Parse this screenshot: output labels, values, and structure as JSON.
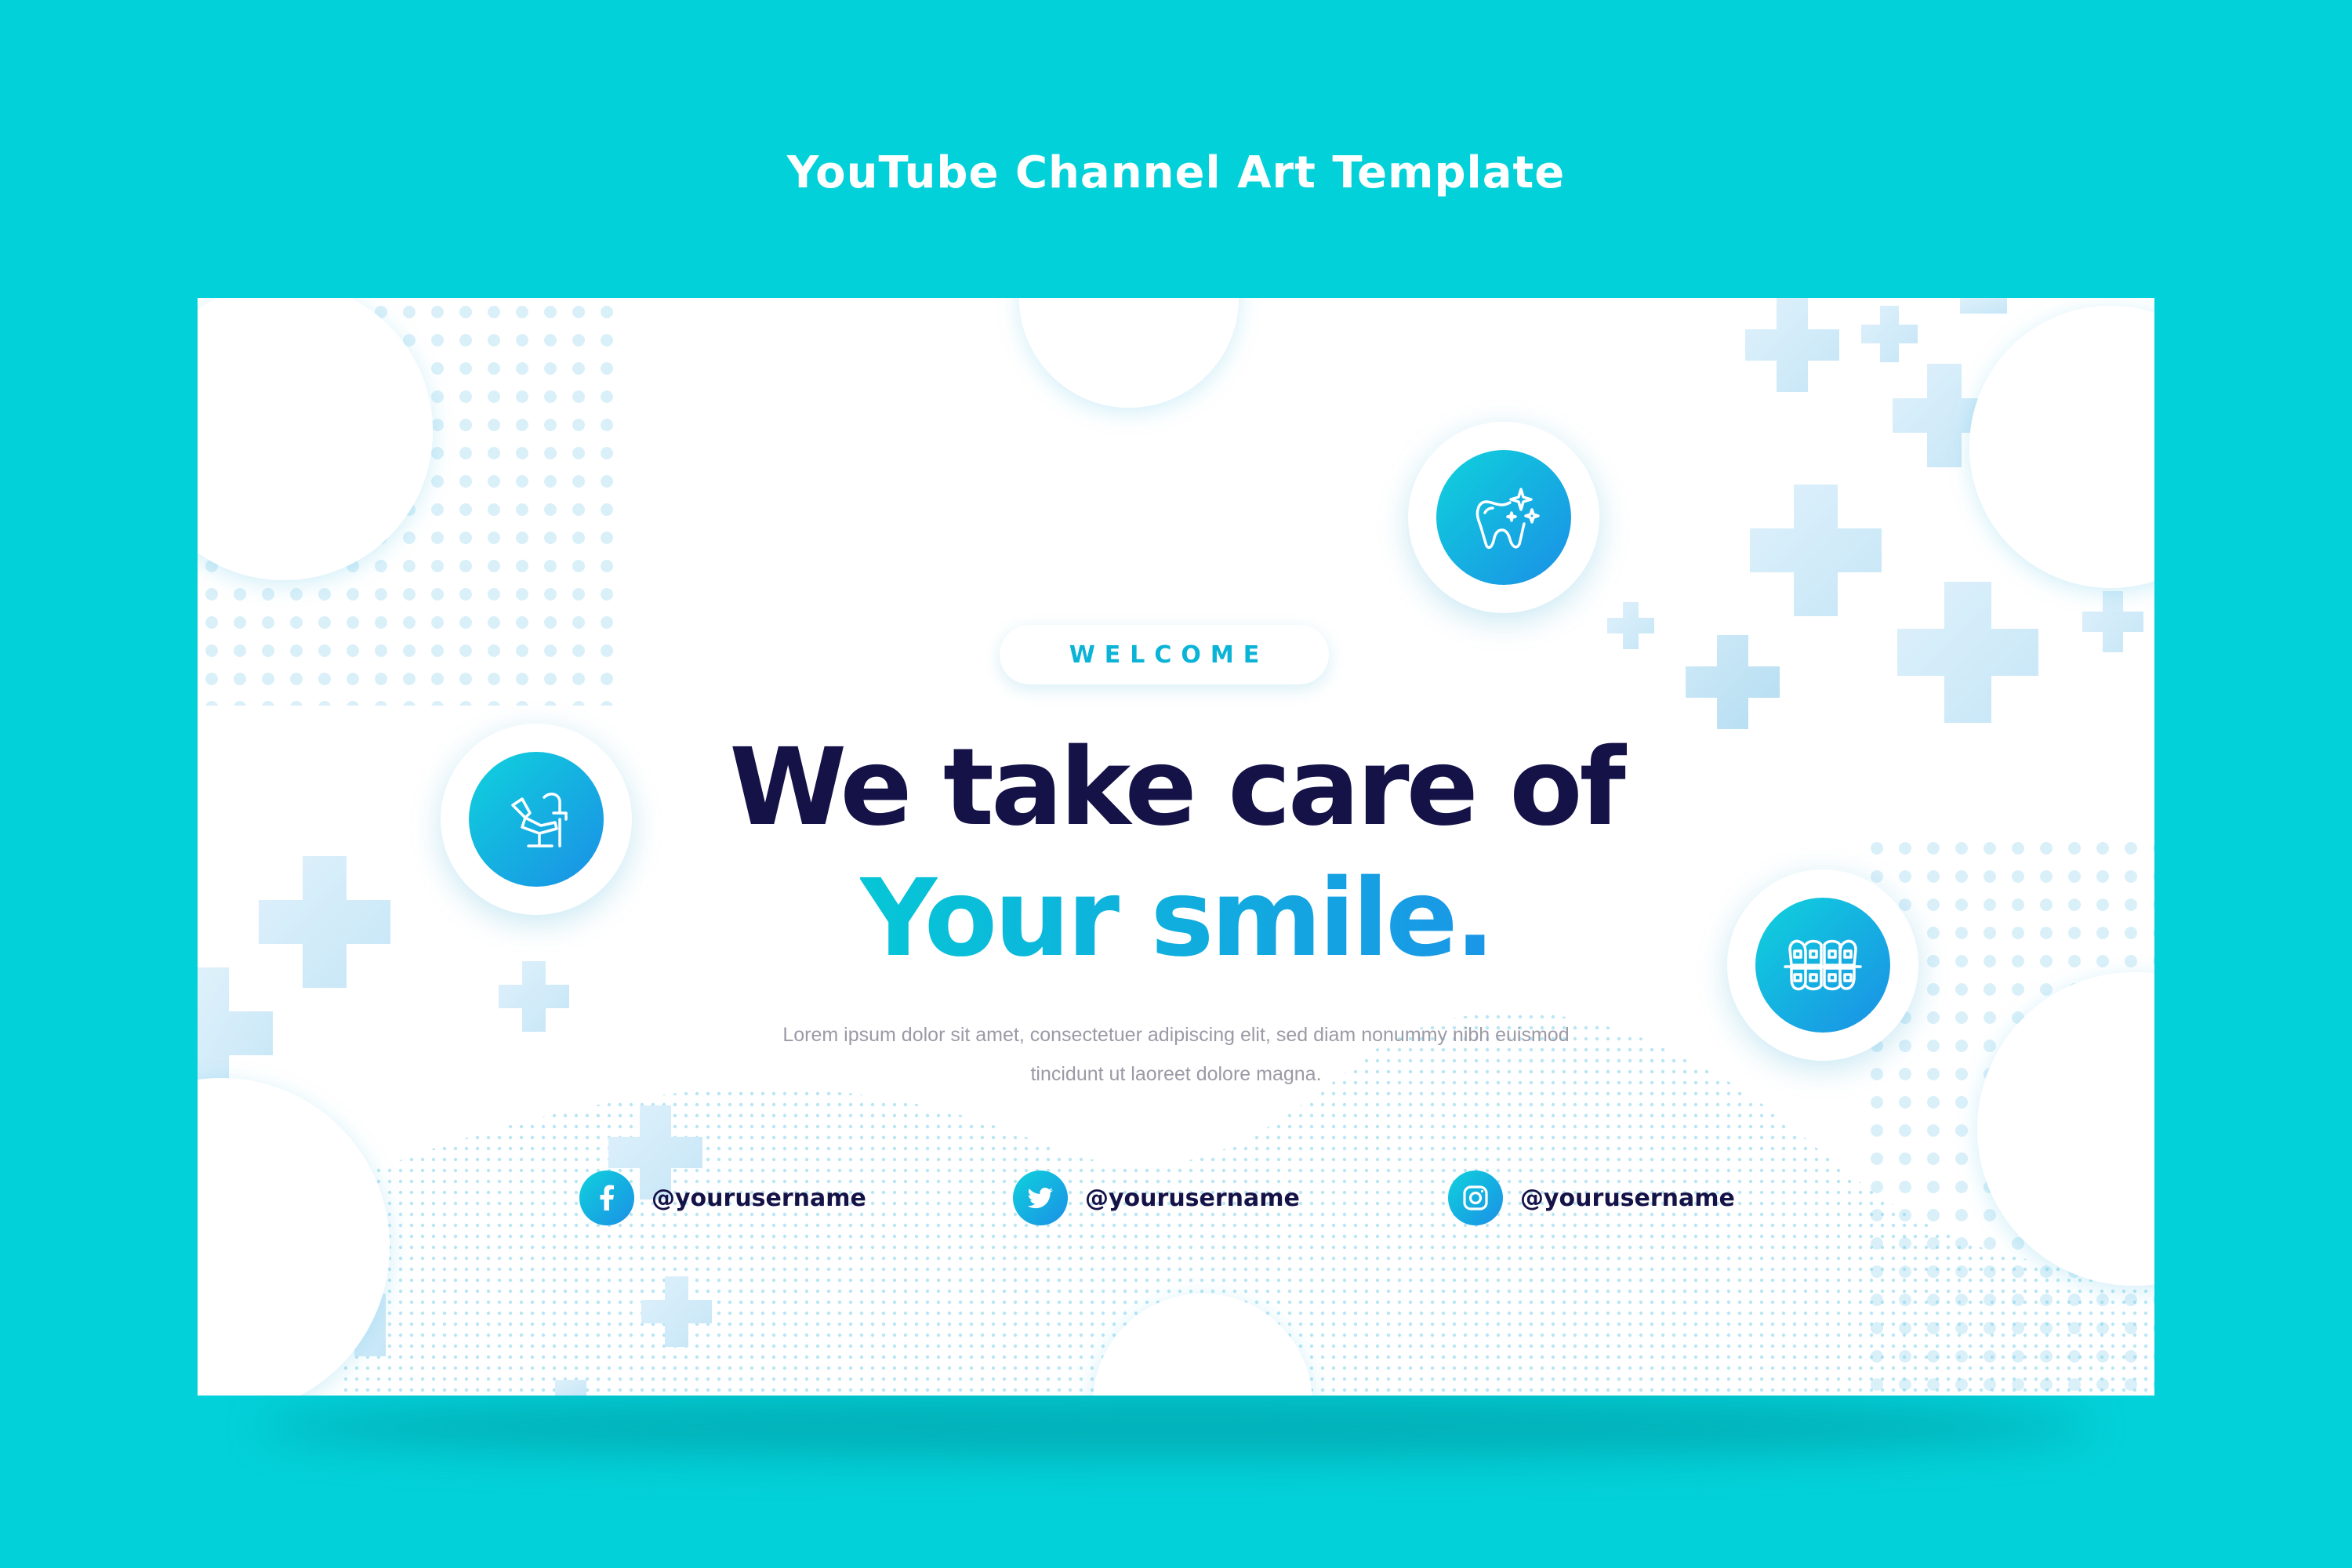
{
  "page": {
    "title": "YouTube Channel Art Template"
  },
  "banner": {
    "welcome_label": "WELCOME",
    "headline": "We take care of",
    "subheadline": "Your smile.",
    "body_line_1": "Lorem ipsum dolor sit amet, consectetuer adipiscing elit, sed diam nonummy nibh euismod",
    "body_line_2": "tincidunt ut laoreet dolore magna.",
    "icons": [
      "dental-chair-icon",
      "sparkling-tooth-icon",
      "braces-icon"
    ],
    "social": [
      {
        "platform": "facebook",
        "icon": "facebook-icon",
        "handle": "@yourusername"
      },
      {
        "platform": "twitter",
        "icon": "twitter-icon",
        "handle": "@yourusername"
      },
      {
        "platform": "instagram",
        "icon": "instagram-icon",
        "handle": "@yourusername"
      }
    ]
  },
  "colors": {
    "background": "#03d1d9",
    "card": "#ffffff",
    "headline": "#151247",
    "accent_start": "#06c6d6",
    "accent_end": "#1a96e6",
    "body_text": "#9b9aa6",
    "welcome_text": "#0bb3d6"
  }
}
